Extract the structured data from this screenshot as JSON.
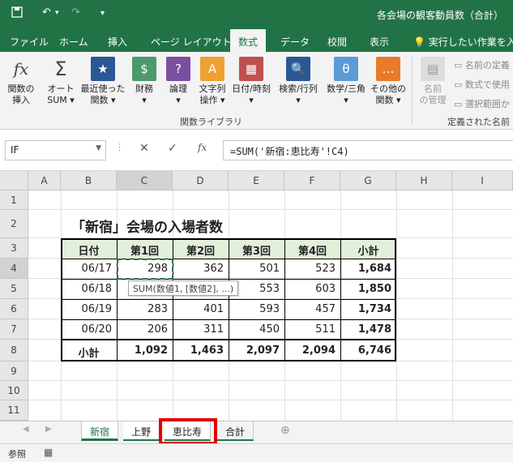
{
  "title": "各会場の観客動員数（合計）",
  "qat": {
    "save": "⌧",
    "undo": "↶",
    "redo": "↷",
    "more": "▾"
  },
  "tabs": [
    "ファイル",
    "ホーム",
    "挿入",
    "ページ レイアウト",
    "数式",
    "データ",
    "校閲",
    "表示",
    "実行したい作業を入力"
  ],
  "ribbon": {
    "b1": "関数の\n挿入",
    "b2": "オート\nSUM ▾",
    "b3": "最近使った\n関数 ▾",
    "b4": "財務\n▾",
    "b5": "論理\n▾",
    "b6": "文字列\n操作 ▾",
    "b7": "日付/時刻\n▾",
    "b8": "検索/行列\n▾",
    "b9": "数学/三角\n▾",
    "b10": "その他の\n関数 ▾",
    "b11": "名前\nの管理",
    "group1": "関数ライブラリ",
    "group2": "定義された名前",
    "d1": "名前の定義",
    "d2": "数式で使用",
    "d3": "選択範囲か"
  },
  "namebox": "IF",
  "formula": "=SUM('新宿:恵比寿'!C4)",
  "fx": "fx",
  "columns": [
    "A",
    "B",
    "C",
    "D",
    "E",
    "F",
    "G",
    "H",
    "I"
  ],
  "rows": [
    "1",
    "2",
    "3",
    "4",
    "5",
    "6",
    "7",
    "8",
    "9",
    "10",
    "11"
  ],
  "sheet_title": "「新宿」会場の入場者数",
  "table": {
    "headers": [
      "日付",
      "第1回",
      "第2回",
      "第3回",
      "第4回",
      "小計"
    ],
    "rows": [
      [
        "06/17",
        "298",
        "362",
        "501",
        "523",
        "1,684"
      ],
      [
        "06/18",
        "",
        "",
        "553",
        "603",
        "1,850"
      ],
      [
        "06/19",
        "283",
        "401",
        "593",
        "457",
        "1,734"
      ],
      [
        "06/20",
        "206",
        "311",
        "450",
        "511",
        "1,478"
      ]
    ],
    "total": [
      "小計",
      "1,092",
      "1,463",
      "2,097",
      "2,094",
      "6,746"
    ]
  },
  "tooltip": "SUM(数値1, [数値2], ...)",
  "sheets": [
    "新宿",
    "上野",
    "恵比寿",
    "合計"
  ],
  "status": "参照",
  "colors": {
    "brand": "#217346",
    "header_fill": "#e2efda",
    "highlight": "#e00000"
  }
}
